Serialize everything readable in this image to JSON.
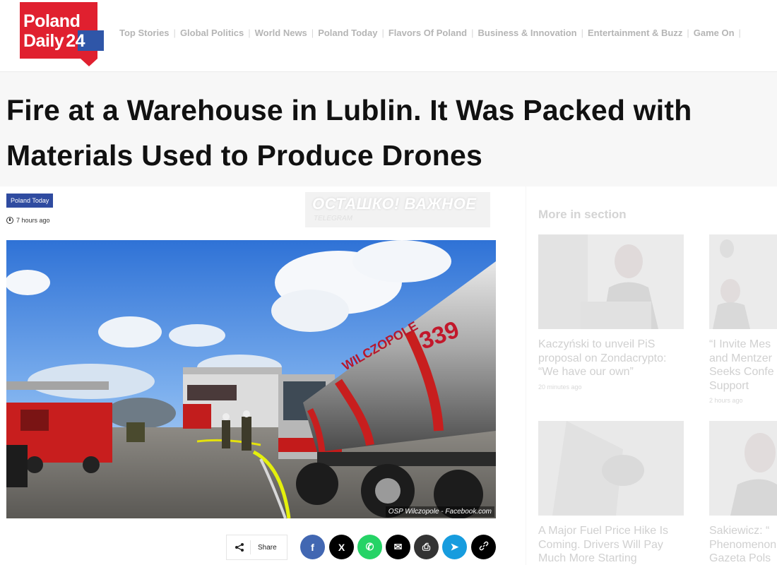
{
  "site": {
    "logo_line1": "Poland",
    "logo_line2": "Daily",
    "logo_number": "24",
    "brand_red": "#e0202f",
    "brand_blue": "#2f56a8"
  },
  "nav": {
    "items": [
      "Top Stories",
      "Global Politics",
      "World News",
      "Poland Today",
      "Flavors Of Poland",
      "Business & Innovation",
      "Entertainment & Buzz",
      "Game On"
    ]
  },
  "article": {
    "title": "Fire at a Warehouse in Lublin. It Was Packed with Materials Used to Produce Drones",
    "category": "Poland Today",
    "time": "7 hours ago",
    "watermark_main": "ОСТАШКО! ВАЖНОЕ",
    "watermark_sub": "TELEGRAM",
    "image_credit": "OSP Wilczopole - Facebook.com",
    "tanker_text": "WILCZOPOLE",
    "tanker_number": "339",
    "share_label": "Share"
  },
  "share_buttons": [
    {
      "icon": "facebook-icon",
      "glyph": "f",
      "color": "#4267b2"
    },
    {
      "icon": "x-icon",
      "glyph": "X",
      "color": "#000000"
    },
    {
      "icon": "whatsapp-icon",
      "glyph": "✆",
      "color": "#25d366"
    },
    {
      "icon": "email-icon",
      "glyph": "✉",
      "color": "#000000"
    },
    {
      "icon": "print-icon",
      "glyph": "⎙",
      "color": "#333333"
    },
    {
      "icon": "telegram-icon",
      "glyph": "➤",
      "color": "#179cde"
    },
    {
      "icon": "copy-link-icon",
      "glyph": "🔗",
      "color": "#000000"
    }
  ],
  "sidebar": {
    "title": "More in section",
    "cards": [
      {
        "title": "Kaczyński to unveil PiS proposal on Zondacrypto: “We have our own”",
        "time": "20 minutes ago"
      },
      {
        "title": "“I Invite Mes and Mentzer Seeks Confe Support",
        "time": "2 hours ago"
      },
      {
        "title": "A Major Fuel Price Hike Is Coming. Drivers Will Pay Much More Starting",
        "time": ""
      },
      {
        "title": "Sakiewicz: “ Phenomenon Gazeta Pols",
        "time": ""
      }
    ]
  }
}
